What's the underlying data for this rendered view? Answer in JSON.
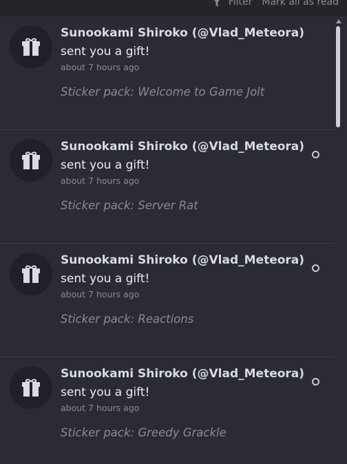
{
  "topbar": {
    "filter_label": "Filter",
    "mark_all_label": "Mark all as read"
  },
  "notifications": [
    {
      "user": "Sunookami Shiroko (@Vlad_Meteora)",
      "action": "sent you a gift!",
      "time": "about 7 hours ago",
      "pack": "Sticker pack: Welcome to Game Jolt",
      "unread": false
    },
    {
      "user": "Sunookami Shiroko (@Vlad_Meteora)",
      "action": "sent you a gift!",
      "time": "about 7 hours ago",
      "pack": "Sticker pack: Server Rat",
      "unread": true
    },
    {
      "user": "Sunookami Shiroko (@Vlad_Meteora)",
      "action": "sent you a gift!",
      "time": "about 7 hours ago",
      "pack": "Sticker pack: Reactions",
      "unread": true
    },
    {
      "user": "Sunookami Shiroko (@Vlad_Meteora)",
      "action": "sent you a gift!",
      "time": "about 7 hours ago",
      "pack": "Sticker pack: Greedy Grackle",
      "unread": true
    }
  ],
  "icons": {
    "filter": "filter-icon",
    "gift": "gift-icon",
    "unread": "unread-dot"
  },
  "colors": {
    "background": "#2b2b33",
    "username": "#d6dbe8",
    "muted": "#8a8b93"
  }
}
